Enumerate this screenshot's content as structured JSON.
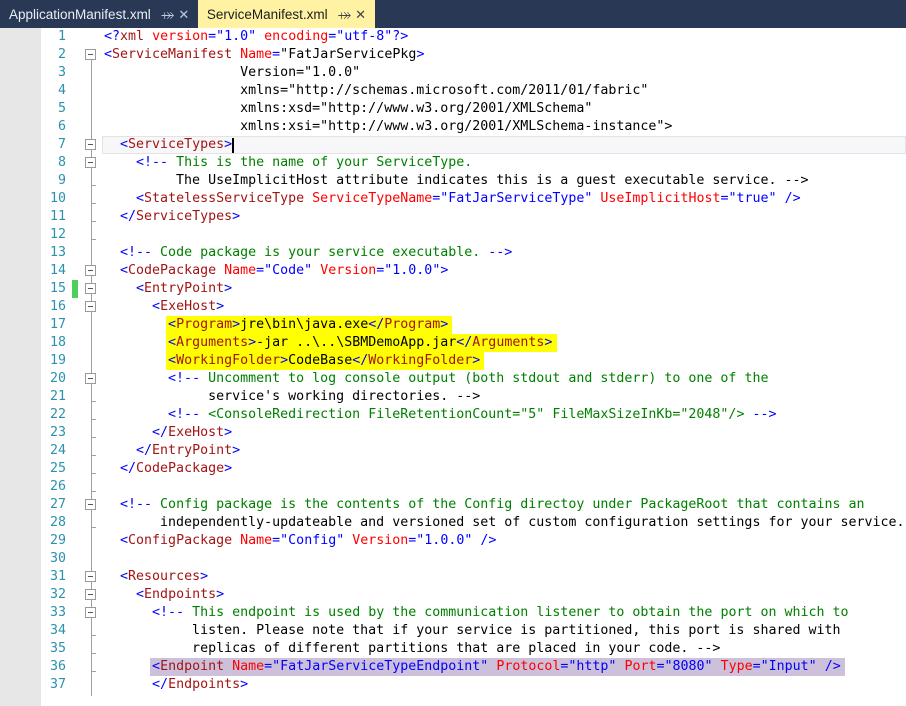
{
  "window": {
    "tab_bar_bg": "#293955",
    "active_tab_bg": "#fff2a3"
  },
  "tabs": [
    {
      "label": "ApplicationManifest.xml",
      "active": false,
      "pin_icon": "pin-icon",
      "close_icon": "close-icon",
      "pin_glyph": "⤀",
      "close_glyph": "✕"
    },
    {
      "label": "ServiceManifest.xml",
      "active": true,
      "pin_icon": "pin-icon",
      "close_icon": "close-icon",
      "pin_glyph": "⤀",
      "close_glyph": "✕"
    }
  ],
  "editor": {
    "language": "xml",
    "file": "ServiceManifest.xml",
    "cursor_line": 7,
    "cursor_column": 18,
    "first_visible_line": 1,
    "last_visible_line": 37,
    "changed_lines": [
      15
    ],
    "fold_markers": [
      2,
      7,
      8,
      14,
      15,
      16,
      20,
      27,
      31,
      32,
      33
    ],
    "highlights": [
      {
        "lines": [
          17,
          18,
          19
        ],
        "color": "#ffff00",
        "name": "yellow-highlight"
      },
      {
        "lines": [
          36
        ],
        "color": "#cdc0da",
        "name": "purple-highlight"
      }
    ],
    "line_numbers": [
      1,
      2,
      3,
      4,
      5,
      6,
      7,
      8,
      9,
      10,
      11,
      12,
      13,
      14,
      15,
      16,
      17,
      18,
      19,
      20,
      21,
      22,
      23,
      24,
      25,
      26,
      27,
      28,
      29,
      30,
      31,
      32,
      33,
      34,
      35,
      36,
      37
    ],
    "lines": [
      "<?xml version=\"1.0\" encoding=\"utf-8\"?>",
      "<ServiceManifest Name=\"FatJarServicePkg\"",
      "                 Version=\"1.0.0\"",
      "                 xmlns=\"http://schemas.microsoft.com/2011/01/fabric\"",
      "                 xmlns:xsd=\"http://www.w3.org/2001/XMLSchema\"",
      "                 xmlns:xsi=\"http://www.w3.org/2001/XMLSchema-instance\">",
      "  <ServiceTypes>",
      "    <!-- This is the name of your ServiceType.",
      "         The UseImplicitHost attribute indicates this is a guest executable service. -->",
      "    <StatelessServiceType ServiceTypeName=\"FatJarServiceType\" UseImplicitHost=\"true\" />",
      "  </ServiceTypes>",
      "",
      "  <!-- Code package is your service executable. -->",
      "  <CodePackage Name=\"Code\" Version=\"1.0.0\">",
      "    <EntryPoint>",
      "      <ExeHost>",
      "        <Program>jre\\bin\\java.exe</Program>",
      "        <Arguments>-jar ..\\..\\SBMDemoApp.jar</Arguments>",
      "        <WorkingFolder>CodeBase</WorkingFolder>",
      "        <!-- Uncomment to log console output (both stdout and stderr) to one of the",
      "             service's working directories. -->",
      "        <!-- <ConsoleRedirection FileRetentionCount=\"5\" FileMaxSizeInKb=\"2048\"/> -->",
      "      </ExeHost>",
      "    </EntryPoint>",
      "  </CodePackage>",
      "",
      "  <!-- Config package is the contents of the Config directoy under PackageRoot that contains an",
      "       independently-updateable and versioned set of custom configuration settings for your service. -->",
      "  <ConfigPackage Name=\"Config\" Version=\"1.0.0\" />",
      "",
      "  <Resources>",
      "    <Endpoints>",
      "      <!-- This endpoint is used by the communication listener to obtain the port on which to",
      "           listen. Please note that if your service is partitioned, this port is shared with",
      "           replicas of different partitions that are placed in your code. -->",
      "      <Endpoint Name=\"FatJarServiceTypeEndpoint\" Protocol=\"http\" Port=\"8080\" Type=\"Input\" />",
      "      </Endpoints>"
    ],
    "colors": {
      "tag": "#a31515",
      "attribute": "#ff0000",
      "value": "#0000ff",
      "comment": "#008000",
      "punctuation": "#0000ff",
      "line_number": "#2b91af",
      "margin": "#e7e7e7",
      "change_bar": "#4ecf5a"
    }
  }
}
